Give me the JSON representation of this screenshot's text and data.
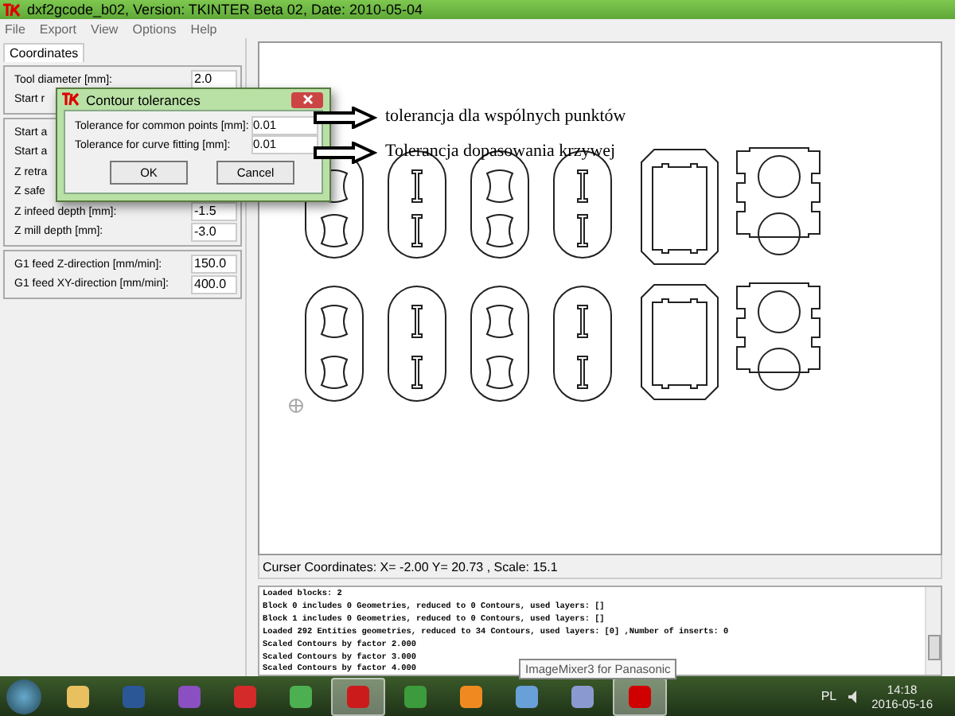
{
  "window": {
    "title": "dxf2gcode_b02, Version: TKINTER Beta 02, Date: 2010-05-04"
  },
  "menu": [
    "File",
    "Export",
    "View",
    "Options",
    "Help"
  ],
  "sidebar": {
    "tab": "Coordinates",
    "groups": [
      [
        {
          "label": "Tool diameter [mm]:",
          "value": "2.0"
        },
        {
          "label": "Start r"
        }
      ],
      [
        {
          "label": "Start a"
        },
        {
          "label": "Start a"
        },
        {
          "label": "Z retra"
        },
        {
          "label": "Z safe"
        },
        {
          "label": "Z infeed depth [mm]:",
          "value": "-1.5"
        },
        {
          "label": "Z mill depth [mm]:",
          "value": "-3.0"
        }
      ],
      [
        {
          "label": "G1 feed Z-direction [mm/min]:",
          "value": "150.0"
        },
        {
          "label": "G1 feed XY-direction [mm/min]:",
          "value": "400.0"
        }
      ]
    ]
  },
  "canvas": {
    "annotations": [
      "tolerancja dla wspólnych punktów",
      "Tolerancja dopasowania krzywej"
    ],
    "status": "Curser Coordinates: X= -2.00 Y= 20.73 , Scale: 15.1"
  },
  "dialog": {
    "title": "Contour tolerances",
    "fields": [
      {
        "label": "Tolerance for common points [mm]:",
        "value": "0.01"
      },
      {
        "label": "Tolerance for curve fitting [mm]:",
        "value": "0.01"
      }
    ],
    "buttons": [
      "OK",
      "Cancel"
    ]
  },
  "log": {
    "lines": [
      "Loaded blocks: 2",
      "Block 0 includes 0 Geometries, reduced to 0 Contours, used layers: []",
      "Block 1 includes 0 Geometries, reduced to 0 Contours, used layers: []",
      "Loaded 292 Entities geometries, reduced to 34 Contours, used layers: [0] ,Number of inserts: 0",
      "Scaled Contours by factor 2.000",
      "Scaled Contours by factor 3.000",
      "Scaled Contours by factor 4.000"
    ]
  },
  "tooltip": "ImageMixer3 for Panasonic",
  "taskbar": {
    "apps": [
      {
        "kind": "folder",
        "active": false
      },
      {
        "kind": "word",
        "active": false
      },
      {
        "kind": "pinwheel",
        "active": false
      },
      {
        "kind": "video",
        "active": false
      },
      {
        "kind": "frog",
        "active": false
      },
      {
        "kind": "opera",
        "active": true
      },
      {
        "kind": "chrome",
        "active": false
      },
      {
        "kind": "gear",
        "active": false
      },
      {
        "kind": "palette",
        "active": false
      },
      {
        "kind": "figure",
        "active": false
      },
      {
        "kind": "tk",
        "active": true
      }
    ],
    "language": "PL",
    "time": "14:18",
    "date": "2016-05-16"
  }
}
